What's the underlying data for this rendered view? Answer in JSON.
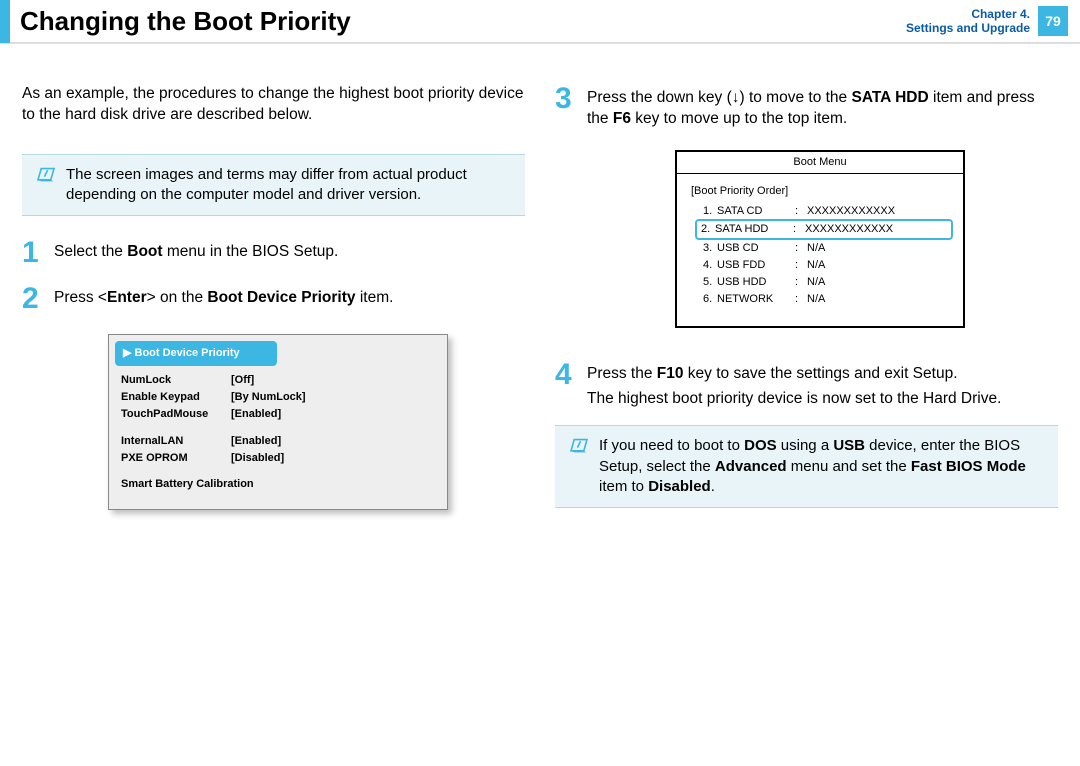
{
  "header": {
    "title": "Changing the Boot Priority",
    "chapter_line1": "Chapter 4.",
    "chapter_line2": "Settings and Upgrade",
    "page_number": "79"
  },
  "left": {
    "intro": "As an example, the procedures to change the highest boot priority device to the hard disk drive are described below.",
    "note": "The screen images and terms may differ from actual product depending on the computer model and driver version.",
    "step1_pre": "Select the ",
    "step1_b1": "Boot",
    "step1_post": " menu in the BIOS Setup.",
    "step2_pre": "Press <",
    "step2_b1": "Enter",
    "step2_mid": "> on the ",
    "step2_b2": "Boot Device Priority",
    "step2_post": " item.",
    "bios": {
      "highlight_prefix": "▶ ",
      "highlight": "Boot Device Priority",
      "rows": [
        {
          "k": "NumLock",
          "v": "[Off]"
        },
        {
          "k": "Enable Keypad",
          "v": "[By NumLock]"
        },
        {
          "k": "TouchPadMouse",
          "v": "[Enabled]"
        }
      ],
      "rows2": [
        {
          "k": "InternalLAN",
          "v": "[Enabled]"
        },
        {
          "k": "PXE OPROM",
          "v": "[Disabled]"
        }
      ],
      "footer": "Smart Battery Calibration"
    }
  },
  "right": {
    "step3_pre": "Press the down key (↓) to move to the ",
    "step3_b1": "SATA HDD",
    "step3_mid": " item and press the ",
    "step3_b2": "F6",
    "step3_post": " key to move up to the top item.",
    "bootmenu": {
      "title": "Boot Menu",
      "subtitle": "[Boot Priority Order]",
      "rows": [
        {
          "n": "1.",
          "dev": "SATA CD",
          "val": "XXXXXXXXXXXX",
          "hl": false
        },
        {
          "n": "2.",
          "dev": "SATA HDD",
          "val": "XXXXXXXXXXXX",
          "hl": true
        },
        {
          "n": "3.",
          "dev": "USB CD",
          "val": "N/A",
          "hl": false
        },
        {
          "n": "4.",
          "dev": "USB FDD",
          "val": "N/A",
          "hl": false
        },
        {
          "n": "5.",
          "dev": "USB HDD",
          "val": "N/A",
          "hl": false
        },
        {
          "n": "6.",
          "dev": "NETWORK",
          "val": "N/A",
          "hl": false
        }
      ]
    },
    "step4_pre": "Press the ",
    "step4_b1": "F10",
    "step4_mid": " key to save the settings and exit Setup.",
    "step4_line2": "The highest boot priority device is now set to the Hard Drive.",
    "note2_pre": "If you need to boot to ",
    "note2_b1": "DOS",
    "note2_mid1": " using a ",
    "note2_b2": "USB",
    "note2_mid2": " device, enter the BIOS Setup, select the ",
    "note2_b3": "Advanced",
    "note2_mid3": " menu and set the ",
    "note2_b4": "Fast BIOS Mode",
    "note2_mid4": " item to ",
    "note2_b5": "Disabled",
    "note2_post": "."
  }
}
